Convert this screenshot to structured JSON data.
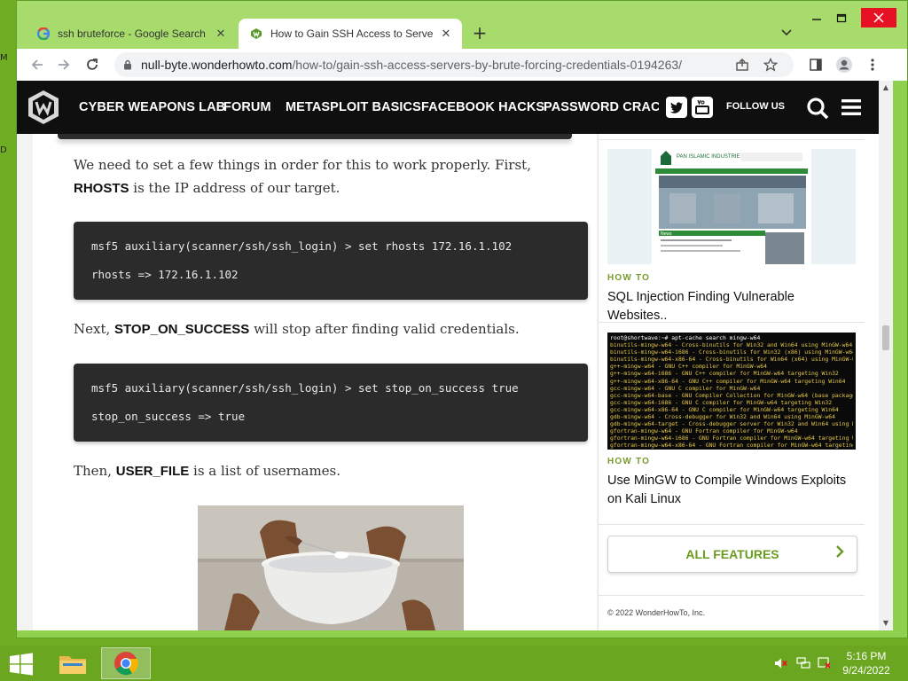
{
  "browser": {
    "tabs": [
      {
        "title": "ssh bruteforce - Google Search",
        "active": false
      },
      {
        "title": "How to Gain SSH Access to Serve",
        "active": true
      }
    ],
    "address": {
      "host": "null-byte.wonderhowto.com",
      "path": "/how-to/gain-ssh-access-servers-by-brute-forcing-credentials-0194263/"
    },
    "close_glyph": "✕",
    "new_tab_glyph": "+",
    "dropdown_glyph": "⌄"
  },
  "site": {
    "nav": [
      "CYBER WEAPONS LAB",
      "FORUM",
      "METASPLOIT BASICS",
      "FACEBOOK HACKS",
      "PASSWORD CRACKIN"
    ],
    "follow_us": "FOLLOW US",
    "social": [
      "twitter-icon",
      "youtube-icon"
    ]
  },
  "article": {
    "para1_pre": "We need to set a few things in order for this to work properly. First, ",
    "para1_bold": "RHOSTS",
    "para1_post": " is the IP address of our target.",
    "code1": [
      "msf5 auxiliary(scanner/ssh/ssh_login) > set rhosts 172.16.1.102",
      "rhosts => 172.16.1.102"
    ],
    "para2_pre": "Next, ",
    "para2_bold": "STOP_ON_SUCCESS",
    "para2_post": " will stop after finding valid credentials.",
    "code2": [
      "msf5 auxiliary(scanner/ssh/ssh_login) > set stop_on_success true",
      "stop_on_success => true"
    ],
    "para3_pre": "Then, ",
    "para3_bold": "USER_FILE",
    "para3_post": " is a list of usernames."
  },
  "sidebar": {
    "card1": {
      "kicker": "HOW TO",
      "title": "SQL Injection Finding Vulnerable Websites.."
    },
    "card2": {
      "kicker": "HOW TO",
      "title": "Use MinGW to Compile Windows Exploits on Kali Linux"
    },
    "all_features": "ALL FEATURES",
    "copyright": "© 2022 WonderHowTo, Inc.",
    "thumb1_text": {
      "org": "PAN ISLAMIC INDUSTRIES",
      "news": "News"
    },
    "thumb2_lines": [
      "root@shortwave:~# apt-cache search mingw-w64",
      "binutils-mingw-w64 - Cross-binutils for Win32 and Win64 using MinGW-w64",
      "binutils-mingw-w64-i686 - Cross-binutils for Win32 (x86) using MinGW-w64",
      "binutils-mingw-w64-x86-64 - Cross-binutils for Win64 (x64) using MinGW-w64",
      "g++-mingw-w64 - GNU C++ compiler for MinGW-w64",
      "g++-mingw-w64-i686 - GNU C++ compiler for MinGW-w64 targeting Win32",
      "g++-mingw-w64-x86-64 - GNU C++ compiler for MinGW-w64 targeting Win64",
      "gcc-mingw-w64 - GNU C compiler for MinGW-w64",
      "gcc-mingw-w64-base - GNU Compiler Collection for MinGW-w64 (base package)",
      "gcc-mingw-w64-i686 - GNU C compiler for MinGW-w64 targeting Win32",
      "gcc-mingw-w64-x86-64 - GNU C compiler for MinGW-w64 targeting Win64",
      "gdb-mingw-w64 - Cross-debugger for Win32 and Win64 using MinGW-w64",
      "gdb-mingw-w64-target - Cross-debugger server for Win32 and Win64 using MinGW",
      "gfortran-mingw-w64 - GNU Fortran compiler for MinGW-w64",
      "gfortran-mingw-w64-i686 - GNU Fortran compiler for MinGW-w64 targeting Win32",
      "gfortran-mingw-w64-x86-64 - GNU Fortran compiler for MinGW-w64 targeting Win64"
    ]
  },
  "taskbar": {
    "time": "5:16 PM",
    "date": "9/24/2022"
  },
  "colors": {
    "window_frame": "#a7db6b",
    "taskbar": "#6aa61f",
    "accent_green": "#6a9b1d",
    "code_bg": "#2b2b2b"
  }
}
